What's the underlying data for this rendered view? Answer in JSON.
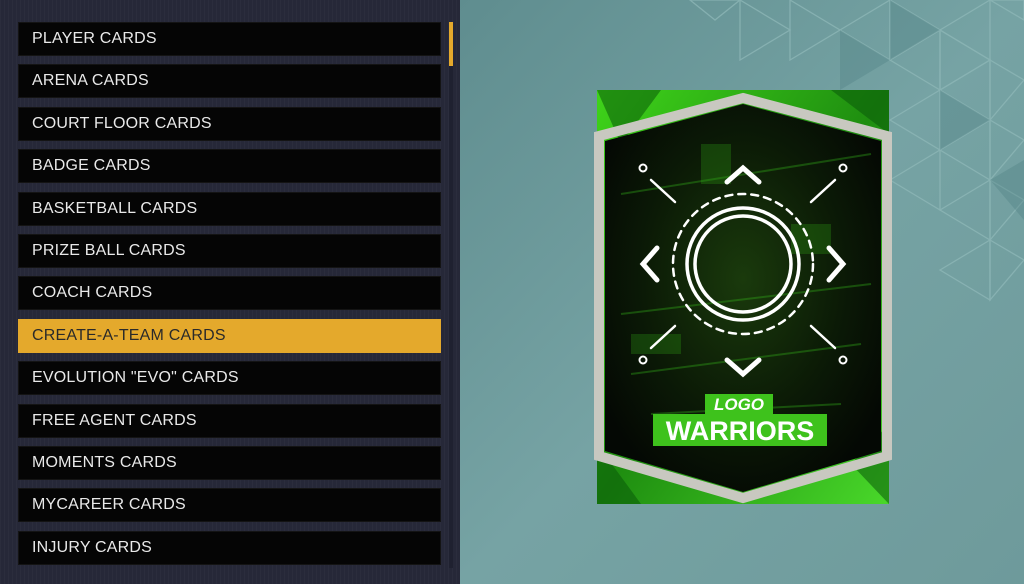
{
  "menu": {
    "items": [
      {
        "label": "PLAYER CARDS"
      },
      {
        "label": "ARENA CARDS"
      },
      {
        "label": "COURT FLOOR CARDS"
      },
      {
        "label": "BADGE CARDS"
      },
      {
        "label": "BASKETBALL CARDS"
      },
      {
        "label": "PRIZE BALL CARDS"
      },
      {
        "label": "COACH CARDS"
      },
      {
        "label": "CREATE-A-TEAM CARDS",
        "selected": true
      },
      {
        "label": "EVOLUTION \"EVO\" CARDS"
      },
      {
        "label": "FREE AGENT CARDS"
      },
      {
        "label": "MOMENTS CARDS"
      },
      {
        "label": "MYCAREER CARDS"
      },
      {
        "label": "INJURY CARDS"
      }
    ]
  },
  "card": {
    "logo_label": "LOGO",
    "team_name": "WARRIORS"
  },
  "colors": {
    "accent": "#e4a92c",
    "card_green": "#3cc21a",
    "preview_bg": "#6f9c9e"
  }
}
